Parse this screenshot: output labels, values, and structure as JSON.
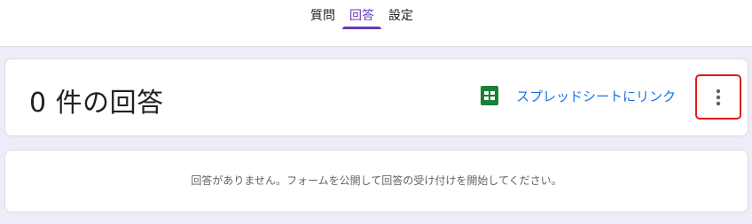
{
  "tabs": [
    {
      "label": "質問"
    },
    {
      "label": "回答"
    },
    {
      "label": "設定"
    }
  ],
  "active_tab": "回答",
  "responses": {
    "title": "0 件の回答",
    "sheets_link_label": "スプレッドシートにリンク",
    "sheets_icon": "google-sheets-icon",
    "more_icon": "more-vert-icon",
    "empty_message": "回答がありません。フォームを公開して回答の受け付けを開始してください。"
  },
  "colors": {
    "accent": "#673ab7",
    "link": "#1a73e8",
    "sheets_green": "#188038",
    "highlight_border": "#e0191b",
    "background": "#f0ebf8"
  }
}
